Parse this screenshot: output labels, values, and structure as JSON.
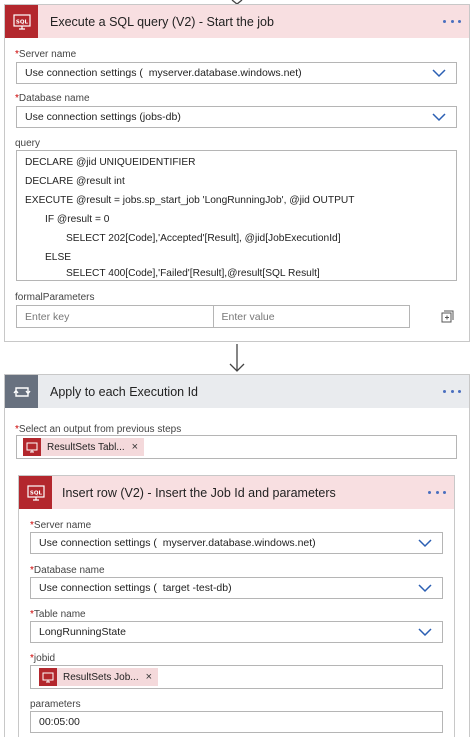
{
  "step1": {
    "title": "Execute a SQL query (V2) - Start the job",
    "icon": "sql-icon",
    "server_label": "Server name",
    "server_value_prefix": "Use connection settings (",
    "server_value_host": "myserver.database.windows.net)",
    "database_label": "Database name",
    "database_value": "Use connection settings (jobs-db)",
    "query_label": "query",
    "query_lines": [
      "DECLARE @jid UNIQUEIDENTIFIER",
      "DECLARE @result int",
      "EXECUTE @result = jobs.sp_start_job 'LongRunningJob', @jid OUTPUT",
      "IF @result = 0",
      "SELECT 202[Code],'Accepted'[Result], @jid[JobExecutionId]",
      "ELSE",
      "SELECT 400[Code],'Failed'[Result],@result[SQL Result]"
    ],
    "formal_label": "formalParameters",
    "key_placeholder": "Enter key",
    "value_placeholder": "Enter value",
    "switch_icon": "switch-to-text-mode-icon"
  },
  "loop": {
    "title": "Apply to each Execution Id",
    "icon": "loop-icon",
    "select_label": "Select an output from previous steps",
    "token_label": "ResultSets Tabl..."
  },
  "step2": {
    "title": "Insert row (V2) - Insert the Job Id and parameters",
    "icon": "sql-icon",
    "server_label": "Server name",
    "server_value_prefix": "Use connection settings (",
    "server_value_host": "myserver.database.windows.net)",
    "database_label": "Database name",
    "database_value_prefix": "Use connection settings (",
    "database_value_host": "target -test-db)",
    "table_label": "Table name",
    "table_value": "LongRunningState",
    "jobid_label": "jobid",
    "jobid_token": "ResultSets Job...",
    "parameters_label": "parameters",
    "parameters_value": "00:05:00"
  },
  "colors": {
    "sql_red": "#b3272d",
    "header_pink": "#f8dfe1",
    "loop_gray": "#68717f",
    "link_blue": "#4a6fbf"
  }
}
